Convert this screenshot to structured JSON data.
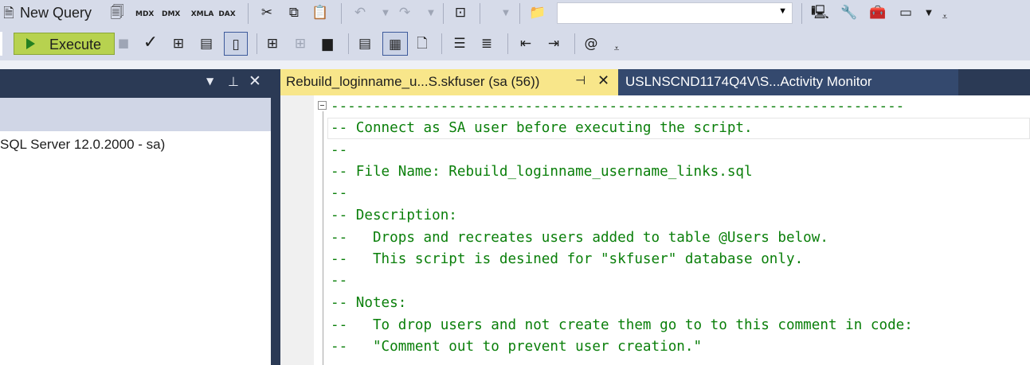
{
  "toolbar1": {
    "new_query_label": "New Query",
    "mdx_label": "MDX",
    "dmx_label": "DMX",
    "xmla_label": "XMLA",
    "dax_label": "DAX",
    "search_value": ""
  },
  "toolbar2": {
    "execute_label": "Execute"
  },
  "object_explorer": {
    "server_node": "SQL Server 12.0.2000 - sa)"
  },
  "tabs": [
    {
      "label": "Rebuild_loginname_u...S.skfuser (sa (56))",
      "active": true
    },
    {
      "label": "USLNSCND1174Q4V\\S...Activity Monitor",
      "active": false
    }
  ],
  "editor": {
    "lines": [
      "--------------------------------------------------------------------",
      "-- Connect as SA user before executing the script.",
      "--",
      "-- File Name: Rebuild_loginname_username_links.sql",
      "--",
      "-- Description:",
      "--   Drops and recreates users added to table @Users below.",
      "--   This script is desined for \"skfuser\" database only.",
      "--",
      "-- Notes:",
      "--   To drop users and not create them go to to this comment in code:",
      "--   \"Comment out to prevent user creation.\""
    ]
  },
  "colors": {
    "comment_green": "#0a7f0a",
    "active_tab": "#f8e68a",
    "execute_button": "#b7d24f",
    "chrome_dark": "#2b3a55"
  }
}
